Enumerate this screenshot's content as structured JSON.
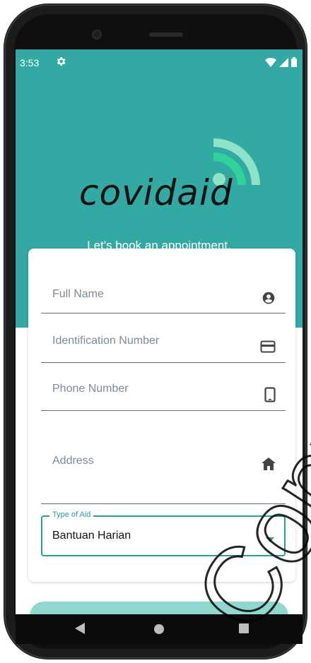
{
  "status_bar": {
    "time": "3:53",
    "icons": [
      "gear-icon",
      "wifi-icon",
      "signal-icon",
      "battery-icon"
    ]
  },
  "brand": {
    "name": "covidaid",
    "tagline": "Let's book an appointment."
  },
  "form": {
    "full_name_placeholder": "Full Name",
    "id_placeholder": "Identification Number",
    "phone_placeholder": "Phone Number",
    "address_placeholder": "Address",
    "type_of_aid_label": "Type of Aid",
    "type_of_aid_value": "Bantuan Harian"
  },
  "colors": {
    "primary": "#33a9a3",
    "accent": "#2b9e96",
    "logo_wave_light": "#8fe3c7",
    "logo_wave_dark": "#2fd39a",
    "button": "#8fd8cf"
  },
  "nav": {
    "icons": [
      "back-icon",
      "home-icon",
      "recents-icon"
    ]
  },
  "watermark": {
    "text": "Copyright@FTSM"
  }
}
